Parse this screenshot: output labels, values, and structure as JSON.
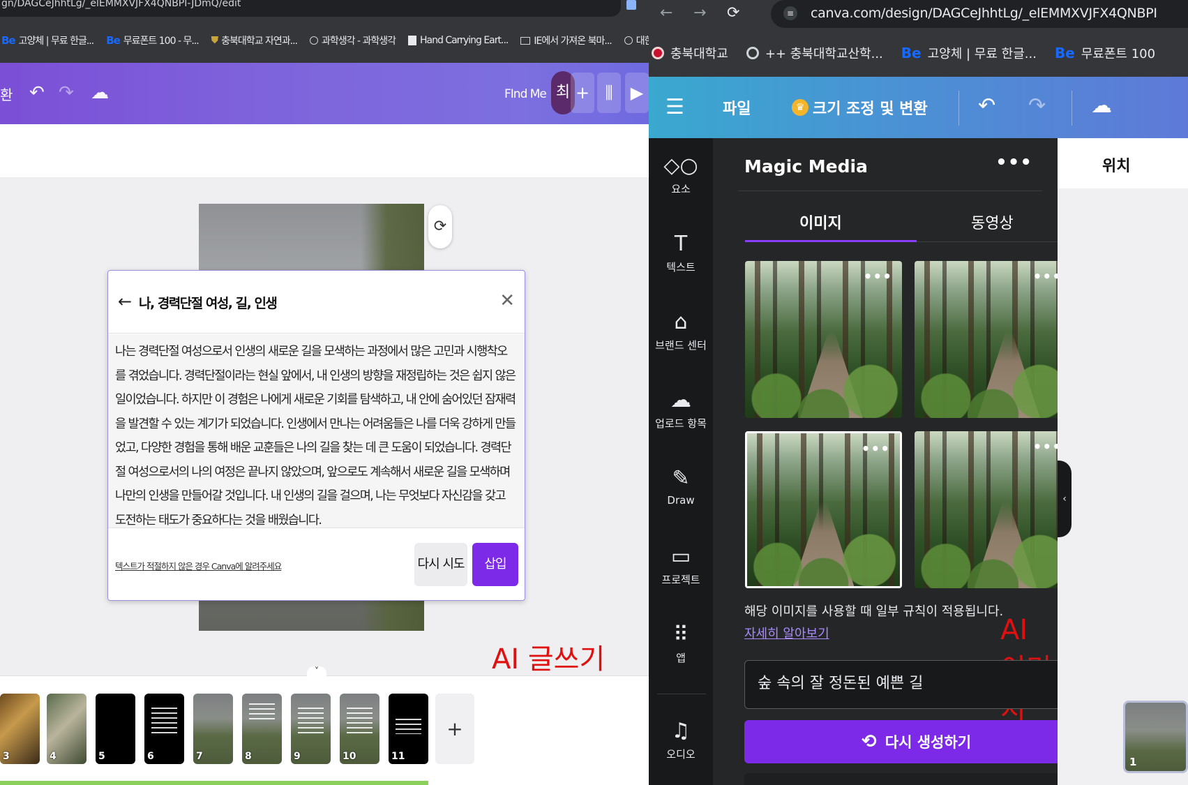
{
  "left": {
    "url": "gn/DAGCeJhhtLg/_elEMMXVJFX4QNBPI-JDmQ/edit",
    "bookmarks": [
      {
        "icon": "Be",
        "label": "고양체 | 무료 한글..."
      },
      {
        "icon": "Be",
        "label": "무료폰트 100 - 무..."
      },
      {
        "icon": "shield",
        "label": "충북대학교 자연과..."
      },
      {
        "icon": "globe",
        "label": "과학생각 - 과학생각"
      },
      {
        "icon": "page",
        "label": "Hand Carrying Eart..."
      },
      {
        "icon": "folder",
        "label": "IE에서 가져온 북마..."
      },
      {
        "icon": "globe",
        "label": "대한안전교육협회"
      }
    ],
    "toolbar": {
      "partial_label": "환",
      "find_me": "FInd Me",
      "avatar": "최"
    },
    "dialog": {
      "title": "나, 경력단절 여성, 길, 인생",
      "body": "나는 경력단절 여성으로서 인생의 새로운 길을 모색하는 과정에서 많은 고민과 시행착오를 겪었습니다. 경력단절이라는 현실 앞에서, 내 인생의 방향을 재정립하는 것은 쉽지 않은 일이었습니다. 하지만 이 경험은 나에게 새로운 기회를 탐색하고, 내 안에 숨어있던 잠재력을 발견할 수 있는 계기가 되었습니다. 인생에서 만나는 어려움들은 나를 더욱 강하게 만들었고, 다양한 경험을 통해 배운 교훈들은 나의 길을 찾는 데 큰 도움이 되었습니다. 경력단절 여성으로서의 나의 여정은 끝나지 않았으며, 앞으로도 계속해서 새로운 길을 모색하며 나만의 인생을 만들어갈 것입니다. 내 인생의 길을 걸으며, 나는 무엇보다 자신감을 갖고 도전하는 태도가 중요하다는 것을 배웠습니다.",
      "report_link": "텍스트가 적절하지 않은 경우 Canva에 알려주세요",
      "retry": "다시 시도",
      "insert": "삽입"
    },
    "annotation": "AI 글쓰기",
    "thumbnails": [
      "3",
      "4",
      "5",
      "6",
      "7",
      "8",
      "9",
      "10",
      "11"
    ]
  },
  "right": {
    "url": "canva.com/design/DAGCeJhhtLg/_elEMMXVJFX4QNBPI",
    "bookmarks": [
      {
        "icon": "dot",
        "label": "충북대학교"
      },
      {
        "icon": "globe",
        "label": "++ 충북대학교산학..."
      },
      {
        "icon": "Be",
        "label": "고양체 | 무료 한글..."
      },
      {
        "icon": "Be",
        "label": "무료폰트 100"
      }
    ],
    "toolbar": {
      "file": "파일",
      "resize": "크기 조정 및 변환"
    },
    "rail": [
      {
        "label": "요소",
        "icon": "shapes-icon"
      },
      {
        "label": "텍스트",
        "icon": "text-icon"
      },
      {
        "label": "브랜드 센터",
        "icon": "brand-icon"
      },
      {
        "label": "업로드 항목",
        "icon": "upload-icon"
      },
      {
        "label": "Draw",
        "icon": "draw-icon"
      },
      {
        "label": "프로젝트",
        "icon": "folder-icon"
      },
      {
        "label": "앱",
        "icon": "apps-icon"
      },
      {
        "label": "오디오",
        "icon": "audio-icon"
      }
    ],
    "panel": {
      "title": "Magic Media",
      "tabs": [
        "이미지",
        "동영상"
      ],
      "active_tab": "이미지",
      "rules": "해당 이미지를 사용할 때 일부 규칙이 적용됩니다.",
      "learn_more": "자세히 알아보기",
      "prompt": "숲 속의 잘 정돈된 예쁜 길",
      "regenerate": "다시 생성하기"
    },
    "annotation": "AI 이미지",
    "side": {
      "title": "위치",
      "page_number": "1"
    },
    "colors": {
      "canva_purple": "#7d2ae8",
      "annotation_red": "#e01010"
    }
  }
}
